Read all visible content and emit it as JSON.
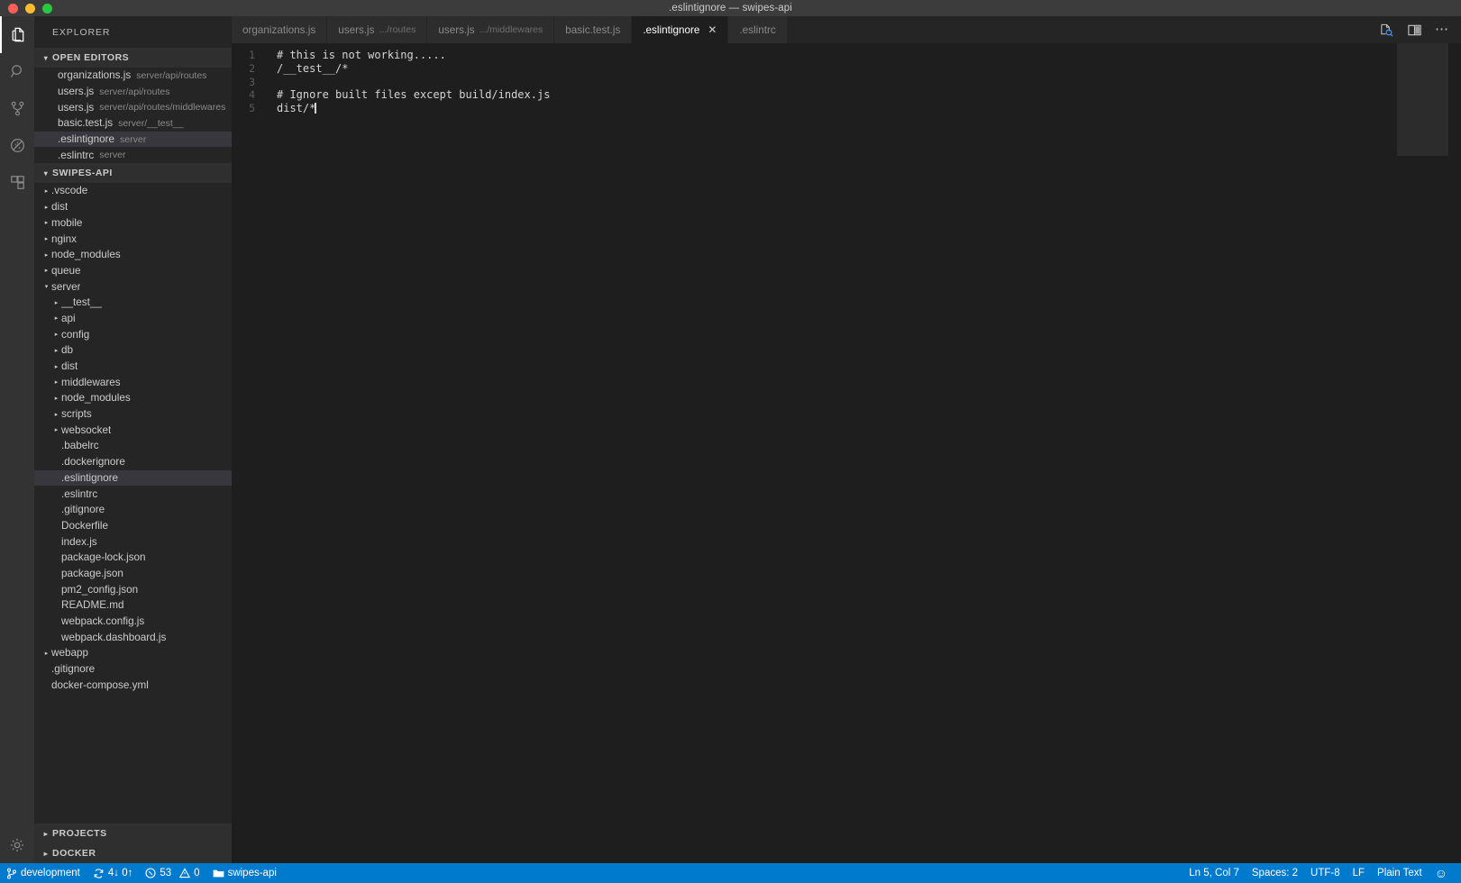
{
  "window": {
    "title": ".eslintignore — swipes-api",
    "controls": [
      "close",
      "minimize",
      "zoom"
    ]
  },
  "activity_bar": {
    "items": [
      {
        "name": "explorer",
        "icon": "files-icon",
        "active": true
      },
      {
        "name": "search",
        "icon": "search-icon",
        "active": false
      },
      {
        "name": "source-control",
        "icon": "source-control-icon",
        "active": false
      },
      {
        "name": "debug",
        "icon": "debug-no-icon",
        "active": false
      },
      {
        "name": "extensions",
        "icon": "extensions-icon",
        "active": false
      }
    ],
    "bottom": [
      {
        "name": "manage",
        "icon": "gear-icon",
        "active": false
      }
    ]
  },
  "sidebar": {
    "title": "EXPLORER",
    "open_editors": {
      "label": "OPEN EDITORS",
      "expanded": true,
      "items": [
        {
          "name": "organizations.js",
          "desc": "server/api/routes",
          "selected": false
        },
        {
          "name": "users.js",
          "desc": "server/api/routes",
          "selected": false
        },
        {
          "name": "users.js",
          "desc": "server/api/routes/middlewares",
          "selected": false
        },
        {
          "name": "basic.test.js",
          "desc": "server/__test__",
          "selected": false
        },
        {
          "name": ".eslintignore",
          "desc": "server",
          "selected": true
        },
        {
          "name": ".eslintrc",
          "desc": "server",
          "selected": false
        }
      ]
    },
    "workspace": {
      "label": "SWIPES-API",
      "expanded": true,
      "items": [
        {
          "name": ".vscode",
          "type": "folder",
          "depth": 1,
          "expanded": false,
          "selected": false
        },
        {
          "name": "dist",
          "type": "folder",
          "depth": 1,
          "expanded": false,
          "selected": false
        },
        {
          "name": "mobile",
          "type": "folder",
          "depth": 1,
          "expanded": false,
          "selected": false
        },
        {
          "name": "nginx",
          "type": "folder",
          "depth": 1,
          "expanded": false,
          "selected": false
        },
        {
          "name": "node_modules",
          "type": "folder",
          "depth": 1,
          "expanded": false,
          "selected": false
        },
        {
          "name": "queue",
          "type": "folder",
          "depth": 1,
          "expanded": false,
          "selected": false
        },
        {
          "name": "server",
          "type": "folder",
          "depth": 1,
          "expanded": true,
          "selected": false
        },
        {
          "name": "__test__",
          "type": "folder",
          "depth": 2,
          "expanded": false,
          "selected": false
        },
        {
          "name": "api",
          "type": "folder",
          "depth": 2,
          "expanded": false,
          "selected": false
        },
        {
          "name": "config",
          "type": "folder",
          "depth": 2,
          "expanded": false,
          "selected": false
        },
        {
          "name": "db",
          "type": "folder",
          "depth": 2,
          "expanded": false,
          "selected": false
        },
        {
          "name": "dist",
          "type": "folder",
          "depth": 2,
          "expanded": false,
          "selected": false
        },
        {
          "name": "middlewares",
          "type": "folder",
          "depth": 2,
          "expanded": false,
          "selected": false
        },
        {
          "name": "node_modules",
          "type": "folder",
          "depth": 2,
          "expanded": false,
          "selected": false
        },
        {
          "name": "scripts",
          "type": "folder",
          "depth": 2,
          "expanded": false,
          "selected": false
        },
        {
          "name": "websocket",
          "type": "folder",
          "depth": 2,
          "expanded": false,
          "selected": false
        },
        {
          "name": ".babelrc",
          "type": "file",
          "depth": 2,
          "expanded": false,
          "selected": false
        },
        {
          "name": ".dockerignore",
          "type": "file",
          "depth": 2,
          "expanded": false,
          "selected": false
        },
        {
          "name": ".eslintignore",
          "type": "file",
          "depth": 2,
          "expanded": false,
          "selected": true
        },
        {
          "name": ".eslintrc",
          "type": "file",
          "depth": 2,
          "expanded": false,
          "selected": false
        },
        {
          "name": ".gitignore",
          "type": "file",
          "depth": 2,
          "expanded": false,
          "selected": false
        },
        {
          "name": "Dockerfile",
          "type": "file",
          "depth": 2,
          "expanded": false,
          "selected": false
        },
        {
          "name": "index.js",
          "type": "file",
          "depth": 2,
          "expanded": false,
          "selected": false
        },
        {
          "name": "package-lock.json",
          "type": "file",
          "depth": 2,
          "expanded": false,
          "selected": false
        },
        {
          "name": "package.json",
          "type": "file",
          "depth": 2,
          "expanded": false,
          "selected": false
        },
        {
          "name": "pm2_config.json",
          "type": "file",
          "depth": 2,
          "expanded": false,
          "selected": false
        },
        {
          "name": "README.md",
          "type": "file",
          "depth": 2,
          "expanded": false,
          "selected": false
        },
        {
          "name": "webpack.config.js",
          "type": "file",
          "depth": 2,
          "expanded": false,
          "selected": false
        },
        {
          "name": "webpack.dashboard.js",
          "type": "file",
          "depth": 2,
          "expanded": false,
          "selected": false
        },
        {
          "name": "webapp",
          "type": "folder",
          "depth": 1,
          "expanded": false,
          "selected": false
        },
        {
          "name": ".gitignore",
          "type": "file",
          "depth": 1,
          "expanded": false,
          "selected": false
        },
        {
          "name": "docker-compose.yml",
          "type": "file",
          "depth": 1,
          "expanded": false,
          "selected": false
        }
      ]
    },
    "bottom_sections": [
      {
        "label": "PROJECTS",
        "expanded": false
      },
      {
        "label": "DOCKER",
        "expanded": false
      }
    ]
  },
  "tabs": {
    "items": [
      {
        "label": "organizations.js",
        "desc": "",
        "active": false,
        "closable": false
      },
      {
        "label": "users.js",
        "desc": ".../routes",
        "active": false,
        "closable": false
      },
      {
        "label": "users.js",
        "desc": ".../middlewares",
        "active": false,
        "closable": false
      },
      {
        "label": "basic.test.js",
        "desc": "",
        "active": false,
        "closable": false
      },
      {
        "label": ".eslintignore",
        "desc": "",
        "active": true,
        "closable": true
      },
      {
        "label": ".eslintrc",
        "desc": "",
        "active": false,
        "closable": false
      }
    ],
    "close_glyph": "✕",
    "actions": [
      {
        "name": "open-preview-icon"
      },
      {
        "name": "split-editor-icon"
      },
      {
        "name": "more-actions-icon",
        "glyph": "⋯"
      }
    ]
  },
  "editor": {
    "language": "Plain Text",
    "lines": [
      {
        "number": "1",
        "text": "# this is not working....."
      },
      {
        "number": "2",
        "text": "/__test__/*"
      },
      {
        "number": "3",
        "text": ""
      },
      {
        "number": "4",
        "text": "# Ignore built files except build/index.js"
      },
      {
        "number": "5",
        "text": "dist/*"
      }
    ],
    "cursor_line": 5
  },
  "status_bar": {
    "branch": "development",
    "sync": "4↓ 0↑",
    "errors": "53",
    "warnings": "0",
    "folder": "swipes-api",
    "position": "Ln 5, Col 7",
    "indentation": "Spaces: 2",
    "encoding": "UTF-8",
    "eol": "LF",
    "language": "Plain Text",
    "feedback_glyph": "☺"
  },
  "colors": {
    "accent": "#007acc",
    "editor_bg": "#1e1e1e",
    "sidebar_bg": "#252526",
    "activity_bg": "#333333",
    "titlebar_bg": "#3c3c3c",
    "selection_bg": "#37373d"
  }
}
